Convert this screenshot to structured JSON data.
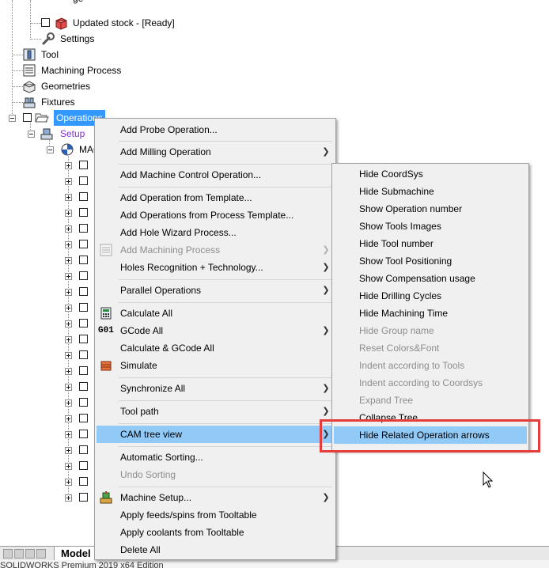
{
  "tree": {
    "top_item_partial": "ge",
    "updated_stock": "Updated stock - [Ready]",
    "settings": "Settings",
    "tool": "Tool",
    "machining_process": "Machining Process",
    "geometries": "Geometries",
    "fixtures": "Fixtures",
    "operations": "Operations",
    "setup": "Setup",
    "mac_partial": "MAC",
    "selected_color": "#3399ff",
    "setup_color": "#8a2be2"
  },
  "context_menu": {
    "items": [
      {
        "label": "Add Probe Operation...",
        "enabled": true,
        "submenu": false
      },
      {
        "label": "Add Milling Operation",
        "enabled": true,
        "submenu": true
      },
      {
        "label": "Add Machine Control Operation...",
        "enabled": true,
        "submenu": false
      },
      {
        "label": "Add Operation from Template...",
        "enabled": true,
        "submenu": false
      },
      {
        "label": "Add Operations from Process Template...",
        "enabled": true,
        "submenu": false
      },
      {
        "label": "Add Hole Wizard Process...",
        "enabled": true,
        "submenu": false
      },
      {
        "label": "Add Machining Process",
        "enabled": false,
        "submenu": true
      },
      {
        "label": "Holes Recognition + Technology...",
        "enabled": true,
        "submenu": true
      },
      {
        "label": "Parallel Operations",
        "enabled": true,
        "submenu": true
      },
      {
        "label": "Calculate All",
        "enabled": true,
        "submenu": false
      },
      {
        "label": "GCode All",
        "enabled": true,
        "submenu": true
      },
      {
        "label": "Calculate & GCode All",
        "enabled": true,
        "submenu": false
      },
      {
        "label": "Simulate",
        "enabled": true,
        "submenu": false
      },
      {
        "label": "Synchronize All",
        "enabled": true,
        "submenu": true
      },
      {
        "label": "Tool path",
        "enabled": true,
        "submenu": true
      },
      {
        "label": "CAM tree view",
        "enabled": true,
        "submenu": true,
        "highlighted": true
      },
      {
        "label": "Automatic Sorting...",
        "enabled": true,
        "submenu": false
      },
      {
        "label": "Undo Sorting",
        "enabled": false,
        "submenu": false
      },
      {
        "label": "Machine Setup...",
        "enabled": true,
        "submenu": true
      },
      {
        "label": "Apply feeds/spins from Tooltable",
        "enabled": true,
        "submenu": false
      },
      {
        "label": "Apply coolants from Tooltable",
        "enabled": true,
        "submenu": false
      },
      {
        "label": "Delete All",
        "enabled": true,
        "submenu": false
      }
    ],
    "gcode_icon_text": "G01",
    "highlight_color": "#91c9f7"
  },
  "submenu": {
    "items": [
      {
        "label": "Hide CoordSys",
        "enabled": true
      },
      {
        "label": "Hide Submachine",
        "enabled": true
      },
      {
        "label": "Show Operation number",
        "enabled": true
      },
      {
        "label": "Show Tools Images",
        "enabled": true
      },
      {
        "label": "Hide Tool number",
        "enabled": true
      },
      {
        "label": "Show Tool Positioning",
        "enabled": true
      },
      {
        "label": "Show Compensation usage",
        "enabled": true
      },
      {
        "label": "Hide Drilling Cycles",
        "enabled": true
      },
      {
        "label": "Hide Machining Time",
        "enabled": true
      },
      {
        "label": "Hide Group name",
        "enabled": false
      },
      {
        "label": "Reset Colors&Font",
        "enabled": false
      },
      {
        "label": "Indent according to Tools",
        "enabled": false
      },
      {
        "label": "Indent according to Coordsys",
        "enabled": false
      },
      {
        "label": "Expand Tree",
        "enabled": false
      },
      {
        "label": "Collapse Tree",
        "enabled": true
      },
      {
        "label": "Hide Related Operation arrows",
        "enabled": true,
        "highlighted": true
      }
    ],
    "annotation_color": "#e53c3c"
  },
  "bottom": {
    "model_tab": "Model",
    "status_partial": "SOLIDWORKS Premium 2019 x64 Edition"
  }
}
